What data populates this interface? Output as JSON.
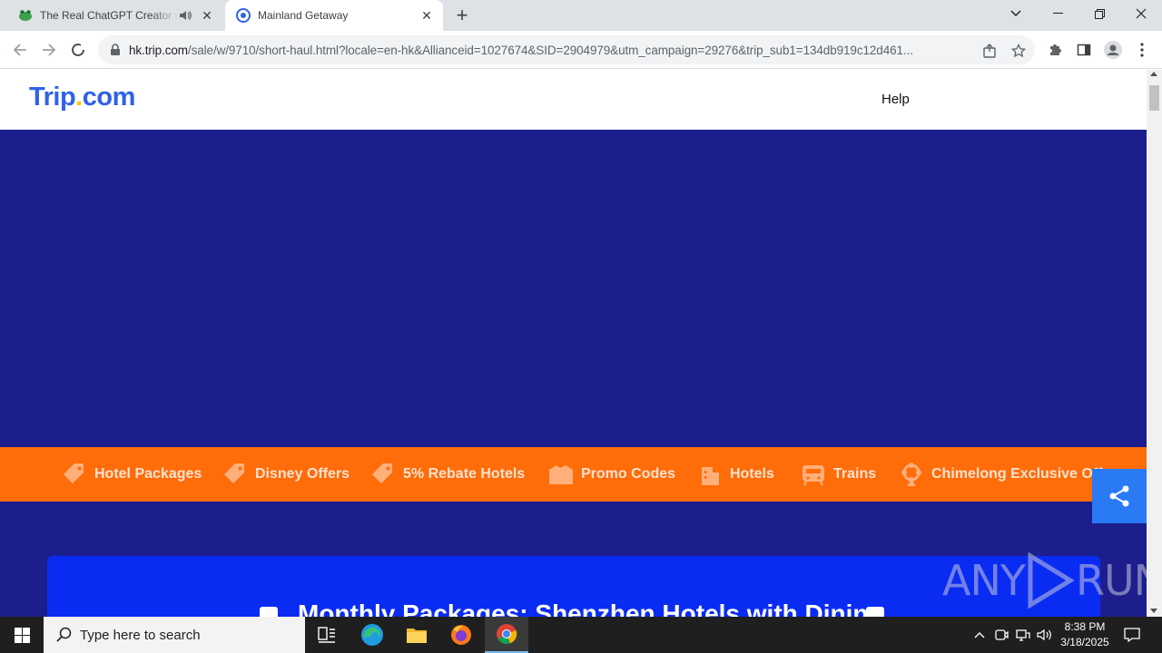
{
  "browser": {
    "tabs": [
      {
        "title": "The Real ChatGPT Creator or",
        "active": false,
        "audio": true
      },
      {
        "title": "Mainland Getaway",
        "active": true,
        "audio": false
      }
    ],
    "url_host": "hk.trip.com",
    "url_path": "/sale/w/9710/short-haul.html?locale=en-hk&Allianceid=1027674&SID=2904979&utm_campaign=29276&trip_sub1=134db919c12d461..."
  },
  "site": {
    "logo_main": "Trip",
    "logo_dot": ".",
    "logo_tail": "com",
    "help_label": "Help"
  },
  "categories": [
    {
      "label": "Hotel Packages",
      "icon": "tag-icon"
    },
    {
      "label": "Disney Offers",
      "icon": "tag-icon"
    },
    {
      "label": "5% Rebate Hotels",
      "icon": "tag-icon"
    },
    {
      "label": "Promo Codes",
      "icon": "ticket-icon"
    },
    {
      "label": "Hotels",
      "icon": "building-icon"
    },
    {
      "label": "Trains",
      "icon": "train-icon"
    },
    {
      "label": "Chimelong Exclusive Offers",
      "icon": "ferris-icon"
    }
  ],
  "promo": {
    "title": "Monthly Packages: Shenzhen Hotels with Dining"
  },
  "watermark": {
    "left": "ANY",
    "right": "RUN"
  },
  "taskbar": {
    "search_placeholder": "Type here to search",
    "time": "8:38 PM",
    "date": "3/18/2025"
  },
  "colors": {
    "hero_bg": "#1b1e8c",
    "category_bar": "#ff6c0a",
    "promo_card": "#0a2cf2",
    "share_button": "#2a7af5",
    "logo_blue": "#2f62e8",
    "logo_yellow": "#ffc400"
  }
}
